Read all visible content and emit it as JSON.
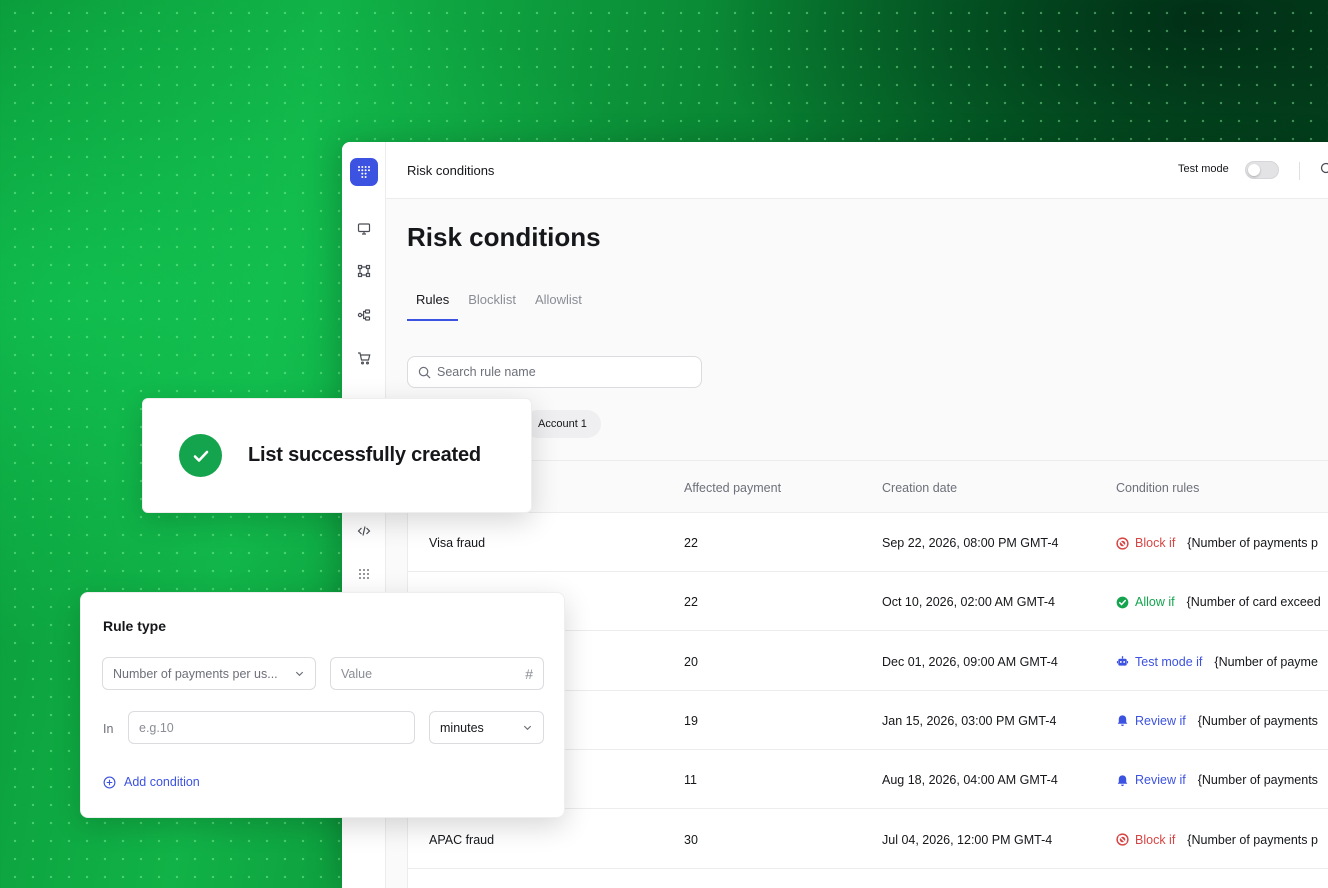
{
  "app": {
    "breadcrumb": "Risk conditions",
    "test_mode_label": "Test mode",
    "page_title": "Risk conditions"
  },
  "tabs": [
    {
      "label": "Rules",
      "active": true
    },
    {
      "label": "Blocklist",
      "active": false
    },
    {
      "label": "Allowlist",
      "active": false
    }
  ],
  "search": {
    "placeholder": "Search rule name"
  },
  "filter_chip": "Account 1",
  "table": {
    "columns": [
      "Affected payment",
      "Creation date",
      "Condition rules"
    ],
    "rows": [
      {
        "name": "Visa fraud",
        "affected": "22",
        "date": "Sep 22, 2026, 08:00 PM GMT-4",
        "rule": "Block if",
        "type": "block",
        "condition": "{Number of payments p"
      },
      {
        "name": "",
        "affected": "22",
        "date": "Oct 10, 2026, 02:00 AM GMT-4",
        "rule": "Allow if",
        "type": "allow",
        "condition": "{Number of card exceed"
      },
      {
        "name": "",
        "affected": "20",
        "date": "Dec 01, 2026, 09:00 AM GMT-4",
        "rule": "Test mode if",
        "type": "test",
        "condition": "{Number of payme"
      },
      {
        "name": "",
        "affected": "19",
        "date": "Jan 15, 2026, 03:00 PM GMT-4",
        "rule": "Review if",
        "type": "review",
        "condition": "{Number of payments"
      },
      {
        "name": "",
        "affected": "11",
        "date": "Aug 18, 2026, 04:00 AM GMT-4",
        "rule": "Review if",
        "type": "review",
        "condition": "{Number of payments"
      },
      {
        "name": "APAC fraud",
        "affected": "30",
        "date": "Jul 04, 2026, 12:00 PM GMT-4",
        "rule": "Block if",
        "type": "block",
        "condition": "{Number of payments p"
      }
    ]
  },
  "toast": {
    "message": "List successfully created"
  },
  "rule_card": {
    "title": "Rule type",
    "metric_select": "Number of payments per us...",
    "value_placeholder": "Value",
    "value_hash": "#",
    "in_label": "In",
    "in_placeholder": "e.g.10",
    "unit_select": "minutes",
    "add_condition": "Add condition"
  },
  "colors": {
    "accent": "#3c52e0",
    "block": "#d64545",
    "allow": "#14a44d",
    "review": "#3c52e0",
    "background_green": "#0a9a3a"
  },
  "icons": {
    "rail": [
      "monitor-icon",
      "nodes-icon",
      "flow-icon",
      "cart-icon",
      "code-icon",
      "grid-dots-icon"
    ],
    "rule_types": {
      "block": "block-icon",
      "allow": "check-circle-icon",
      "test": "robot-icon",
      "review": "bell-icon"
    }
  }
}
